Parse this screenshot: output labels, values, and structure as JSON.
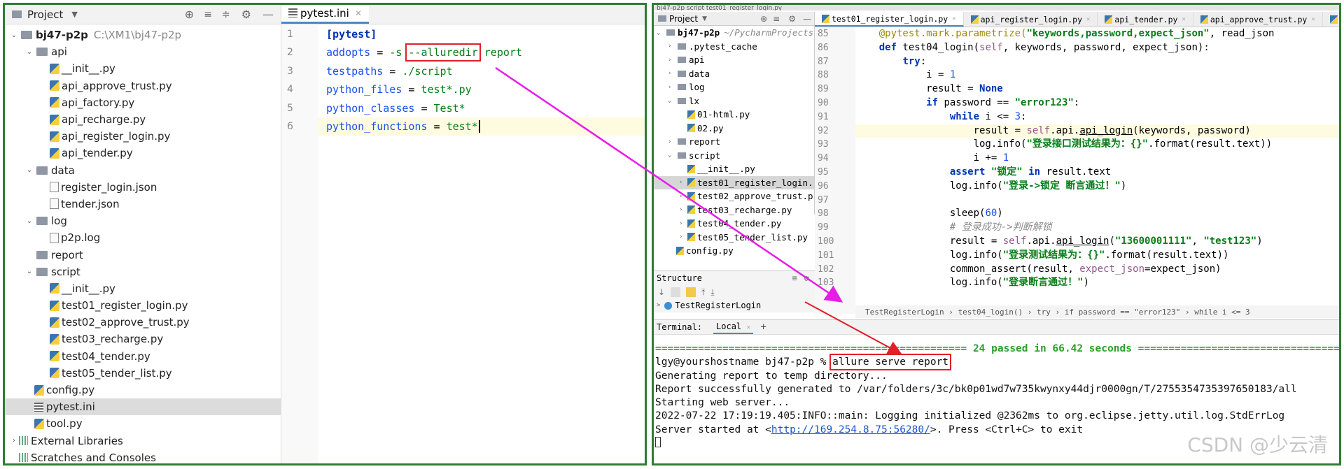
{
  "left": {
    "project_header": {
      "label": "Project"
    },
    "tree": [
      {
        "level": 0,
        "kind": "folder",
        "arrow": "v",
        "label": "bj47-p2p",
        "extra": "C:\\XM1\\bj47-p2p"
      },
      {
        "level": 1,
        "kind": "folder",
        "arrow": "v",
        "label": "api"
      },
      {
        "level": 2,
        "kind": "py",
        "label": "__init__.py"
      },
      {
        "level": 2,
        "kind": "py",
        "label": "api_approve_trust.py"
      },
      {
        "level": 2,
        "kind": "py",
        "label": "api_factory.py"
      },
      {
        "level": 2,
        "kind": "py",
        "label": "api_recharge.py"
      },
      {
        "level": 2,
        "kind": "py",
        "label": "api_register_login.py"
      },
      {
        "level": 2,
        "kind": "py",
        "label": "api_tender.py"
      },
      {
        "level": 1,
        "kind": "folder",
        "arrow": "v",
        "label": "data"
      },
      {
        "level": 2,
        "kind": "file",
        "label": "register_login.json"
      },
      {
        "level": 2,
        "kind": "file",
        "label": "tender.json"
      },
      {
        "level": 1,
        "kind": "folder",
        "arrow": "v",
        "label": "log"
      },
      {
        "level": 2,
        "kind": "file",
        "label": "p2p.log"
      },
      {
        "level": 1,
        "kind": "folder",
        "arrow": "",
        "label": "report"
      },
      {
        "level": 1,
        "kind": "folder",
        "arrow": "v",
        "label": "script"
      },
      {
        "level": 2,
        "kind": "py",
        "label": "__init__.py"
      },
      {
        "level": 2,
        "kind": "py",
        "label": "test01_register_login.py"
      },
      {
        "level": 2,
        "kind": "py",
        "label": "test02_approve_trust.py"
      },
      {
        "level": 2,
        "kind": "py",
        "label": "test03_recharge.py"
      },
      {
        "level": 2,
        "kind": "py",
        "label": "test04_tender.py"
      },
      {
        "level": 2,
        "kind": "py",
        "label": "test05_tender_list.py"
      },
      {
        "level": 1,
        "kind": "py",
        "label": "config.py"
      },
      {
        "level": 1,
        "kind": "ini",
        "label": "pytest.ini",
        "selected": true
      },
      {
        "level": 1,
        "kind": "py",
        "label": "tool.py"
      },
      {
        "level": 0,
        "kind": "lib",
        "arrow": ">",
        "label": "External Libraries"
      },
      {
        "level": 0,
        "kind": "lib",
        "arrow": "",
        "label": "Scratches and Consoles"
      }
    ],
    "editor": {
      "tab_label": "pytest.ini",
      "line_numbers": [
        "1",
        "2",
        "3",
        "4",
        "5",
        "6"
      ],
      "lines": [
        {
          "key": "[pytest]"
        },
        {
          "key": "addopts",
          "op": " = ",
          "val1": "-s ",
          "boxed": "--alluredir",
          "val2": " report"
        },
        {
          "key": "testpaths",
          "op": " = ",
          "val1": "./script"
        },
        {
          "key": "python_files",
          "op": " = ",
          "val1": "test*.py"
        },
        {
          "key": "python_classes",
          "op": " = ",
          "val1": "Test*"
        },
        {
          "key": "python_functions",
          "op": " = ",
          "val1": "test*"
        }
      ]
    }
  },
  "right": {
    "top_crumb": "bj47-p2p  script  test01_register_login.py",
    "project_header": "Project",
    "project_tree": [
      {
        "indent": 0,
        "arrow": "v",
        "kind": "folder",
        "label": "bj47-p2p",
        "extra": "~/PycharmProjects"
      },
      {
        "indent": 1,
        "arrow": ">",
        "kind": "folder",
        "label": ".pytest_cache"
      },
      {
        "indent": 1,
        "arrow": ">",
        "kind": "folder",
        "label": "api"
      },
      {
        "indent": 1,
        "arrow": ">",
        "kind": "folder",
        "label": "data"
      },
      {
        "indent": 1,
        "arrow": ">",
        "kind": "folder",
        "label": "log"
      },
      {
        "indent": 1,
        "arrow": "v",
        "kind": "folder",
        "label": "lx"
      },
      {
        "indent": 2,
        "arrow": "",
        "kind": "py",
        "label": "01-html.py"
      },
      {
        "indent": 2,
        "arrow": "",
        "kind": "py",
        "label": "02.py"
      },
      {
        "indent": 1,
        "arrow": ">",
        "kind": "folder",
        "label": "report"
      },
      {
        "indent": 1,
        "arrow": "v",
        "kind": "folder",
        "label": "script"
      },
      {
        "indent": 2,
        "arrow": "",
        "kind": "py",
        "label": "__init__.py"
      },
      {
        "indent": 2,
        "arrow": ">",
        "kind": "py",
        "label": "test01_register_login.",
        "selected": true
      },
      {
        "indent": 2,
        "arrow": ">",
        "kind": "py",
        "label": "test02_approve_trust.p"
      },
      {
        "indent": 2,
        "arrow": ">",
        "kind": "py",
        "label": "test03_recharge.py"
      },
      {
        "indent": 2,
        "arrow": ">",
        "kind": "py",
        "label": "test04_tender.py"
      },
      {
        "indent": 2,
        "arrow": ">",
        "kind": "py",
        "label": "test05_tender_list.py"
      },
      {
        "indent": 1,
        "arrow": "",
        "kind": "py",
        "label": "config.py"
      }
    ],
    "structure": {
      "label": "Structure",
      "class_label": "TestRegisterLogin"
    },
    "tabs": [
      {
        "label": "test01_register_login.py",
        "active": true
      },
      {
        "label": "api_register_login.py"
      },
      {
        "label": "api_tender.py"
      },
      {
        "label": "api_approve_trust.py"
      },
      {
        "label": "api_fa"
      }
    ],
    "code_line_numbers": [
      "85",
      "86",
      "87",
      "88",
      "89",
      "90",
      "91",
      "92",
      "93",
      "94",
      "95",
      "96",
      "97",
      "98",
      "99",
      "100",
      "101",
      "102",
      "103"
    ],
    "breadcrumb": "TestRegisterLogin  ›  test04_login()  ›  try  ›  if password == \"error123\"  ›  while i <= 3",
    "terminal": {
      "label": "Terminal:",
      "tab": "Local",
      "passed_line": "=================================================== 24 passed in 66.42 seconds ====================================================",
      "prompt": "lgy@yourshostname bj47-p2p % ",
      "command": "allure serve report",
      "out1": "Generating report to temp directory...",
      "out2": "Report successfully generated to /var/folders/3c/bk0p01wd7w735kwynxy44djr0000gn/T/2755354735397650183/all",
      "out3": "Starting web server...",
      "out4": "2022-07-22 17:19:19.405:INFO::main: Logging initialized @2362ms to org.eclipse.jetty.util.log.StdErrLog",
      "out5a": "Server started at <",
      "out5link": "http://169.254.8.75:56280/",
      "out5b": ">. Press <Ctrl+C> to exit"
    }
  },
  "watermark": "CSDN @少云清",
  "colors": {
    "border": "#2e7d32",
    "arrow": "#e81ce8",
    "highlight_box": "#e0202a"
  }
}
